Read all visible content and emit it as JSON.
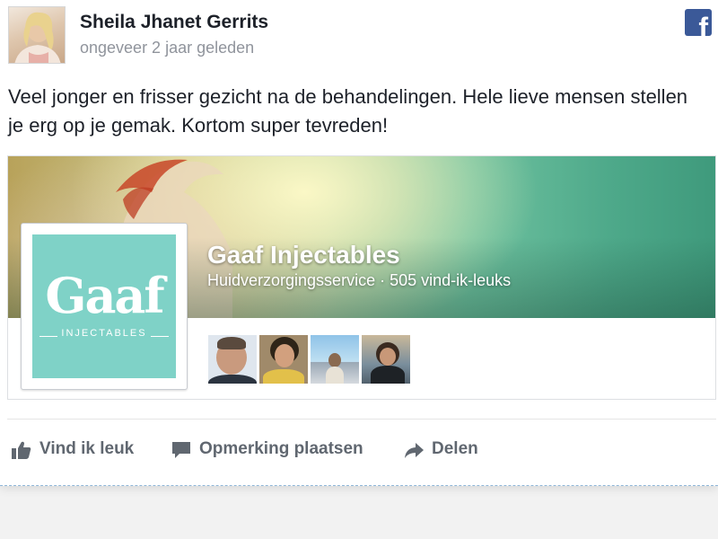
{
  "post": {
    "author": "Sheila Jhanet Gerrits",
    "timestamp": "ongeveer 2 jaar geleden",
    "message": "Veel jonger en frisser gezicht na de behandelingen. Hele lieve mensen stellen je erg op je gemak. Kortom super tevreden!",
    "source_icon": "facebook-icon"
  },
  "page_card": {
    "name": "Gaaf Injectables",
    "meta": "Huidverzorgingsservice · 505 vind-ik-leuks",
    "logo": {
      "word": "Gaaf",
      "subtitle": "INJECTABLES"
    },
    "friends": [
      "friend-avatar",
      "friend-avatar",
      "friend-avatar",
      "friend-avatar"
    ]
  },
  "actions": {
    "like": "Vind ik leuk",
    "comment": "Opmerking plaatsen",
    "share": "Delen"
  },
  "colors": {
    "facebook_blue": "#3b5998",
    "logo_teal": "#7fd2c7",
    "secondary_text": "#90949c",
    "action_text": "#606770"
  }
}
